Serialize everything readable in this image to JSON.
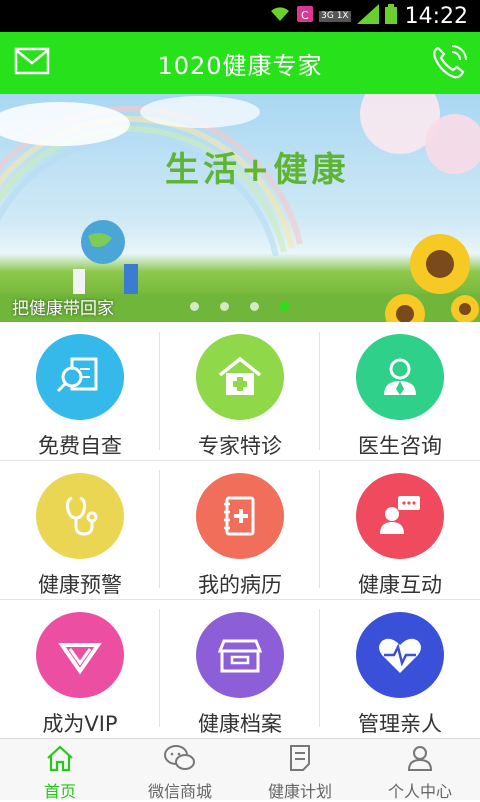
{
  "status_bar": {
    "time": "14:22",
    "network_label": "3G 1X"
  },
  "header": {
    "title": "1020健康专家",
    "left_icon": "mail-icon",
    "right_icon": "phone-icon"
  },
  "banner": {
    "slogan": "生活+健康",
    "caption": "把健康带回家",
    "page_count": 4,
    "active_page": 4
  },
  "grid": {
    "items": [
      {
        "label": "免费自查",
        "icon": "search-document-icon",
        "color": "#35b9ea"
      },
      {
        "label": "专家特诊",
        "icon": "clinic-house-icon",
        "color": "#8fd84a"
      },
      {
        "label": "医生咨询",
        "icon": "doctor-icon",
        "color": "#2fd08a"
      },
      {
        "label": "健康预警",
        "icon": "stethoscope-icon",
        "color": "#ebd653"
      },
      {
        "label": "我的病历",
        "icon": "medical-record-icon",
        "color": "#f06e5a"
      },
      {
        "label": "健康互动",
        "icon": "chat-people-icon",
        "color": "#f04a5e"
      },
      {
        "label": "成为VIP",
        "icon": "vip-diamond-icon",
        "color": "#ec4fa2"
      },
      {
        "label": "健康档案",
        "icon": "archive-box-icon",
        "color": "#8c5fd8"
      },
      {
        "label": "管理亲人",
        "icon": "heart-monitor-icon",
        "color": "#3b50d8"
      }
    ]
  },
  "tabbar": {
    "tabs": [
      {
        "label": "首页",
        "icon": "home-icon",
        "active": true
      },
      {
        "label": "微信商城",
        "icon": "wechat-icon",
        "active": false
      },
      {
        "label": "健康计划",
        "icon": "plan-document-icon",
        "active": false
      },
      {
        "label": "个人中心",
        "icon": "user-icon",
        "active": false
      }
    ]
  }
}
